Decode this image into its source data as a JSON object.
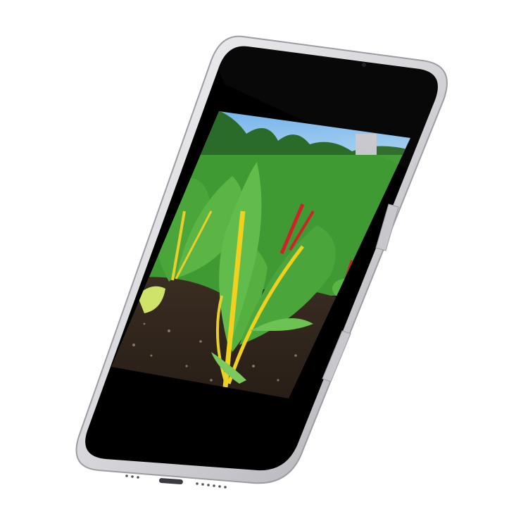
{
  "scene": {
    "background_color": "#ffffff",
    "device": {
      "type": "smartphone",
      "frame_color": "#d9d9dc",
      "frame_edge_color": "#b9b9be",
      "screen_color": "#000000"
    },
    "photo": {
      "subject": "swiss-chard-garden",
      "sky_color": "#8fc3ef",
      "foliage_color": "#2f8f2a",
      "stem_colors": [
        "#f0d21e",
        "#d3252b"
      ],
      "soil_color": "#2e241c"
    }
  }
}
